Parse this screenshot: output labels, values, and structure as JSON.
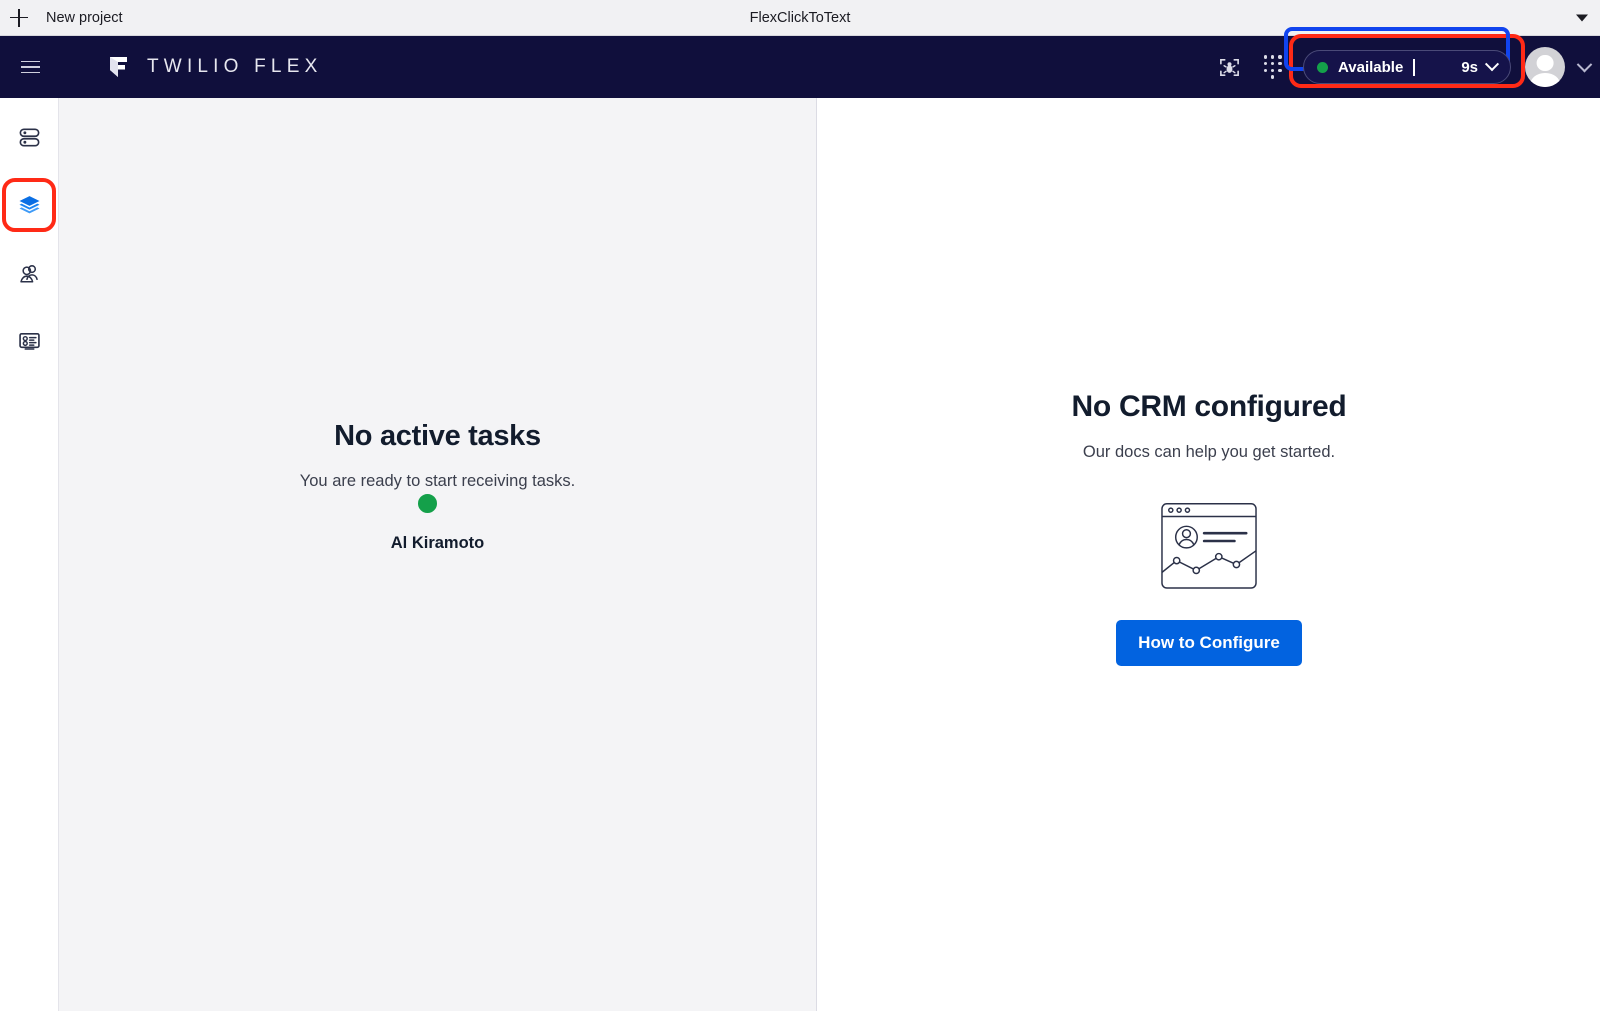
{
  "browser": {
    "new_project_label": "New project",
    "plus_icon": "plus-icon",
    "window_title": "FlexClickToText",
    "caret_icon": "chevron-down-icon"
  },
  "header": {
    "menu_icon": "hamburger-menu-icon",
    "brand_logo_icon": "twilio-flex-logo-icon",
    "brand_text": "TWILIO FLEX",
    "debugger_icon": "bug-in-frame-icon",
    "dialpad_icon": "dialpad-icon",
    "status": {
      "presence_dot_icon": "presence-dot-icon",
      "presence_color": "#14a04a",
      "label": "Available",
      "timer": "9s",
      "caret_icon": "chevron-down-icon",
      "annotation_color": "#ff2a16",
      "focus_color": "#1144ee"
    },
    "avatar_icon": "user-avatar-icon",
    "user_caret_icon": "chevron-down-icon"
  },
  "sidebar": {
    "items": [
      {
        "icon": "tasks-list-icon",
        "name": "sidebar-item-tasks",
        "active": false
      },
      {
        "icon": "layers-icon",
        "name": "sidebar-item-agent-desktop",
        "active": true
      },
      {
        "icon": "teams-people-icon",
        "name": "sidebar-item-teams",
        "active": false
      },
      {
        "icon": "queues-stats-icon",
        "name": "sidebar-item-queues-stats",
        "active": false
      }
    ],
    "active_color": "#0263e0",
    "annotation_color": "#ff2a16"
  },
  "tasks_panel": {
    "title": "No active tasks",
    "subtitle": "You are ready to start receiving tasks.",
    "agent": {
      "avatar_icon": "user-avatar-icon",
      "presence_icon": "presence-dot-icon",
      "presence_color": "#14a04a",
      "name": "Al Kiramoto"
    }
  },
  "crm_panel": {
    "title": "No CRM configured",
    "subtitle": "Our docs can help you get started.",
    "illustration_icon": "crm-browser-window-illustration",
    "button_label": "How to Configure",
    "button_color": "#0263e0"
  }
}
